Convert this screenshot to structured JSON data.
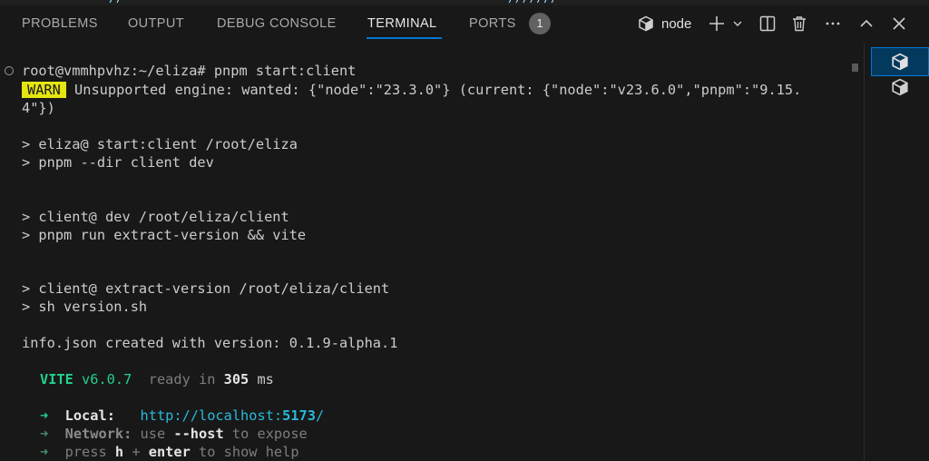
{
  "top_strip": {
    "fragments": [
      {
        "text": "// ---"
      },
      {
        "text": "─ ─ ─ ─"
      },
      {
        "text": "///////"
      },
      {
        "text": "─ ─ ─ ─ ─ ─"
      }
    ]
  },
  "panel": {
    "tabs": [
      {
        "label": "PROBLEMS",
        "active": false
      },
      {
        "label": "OUTPUT",
        "active": false
      },
      {
        "label": "DEBUG CONSOLE",
        "active": false
      },
      {
        "label": "TERMINAL",
        "active": true
      },
      {
        "label": "PORTS",
        "active": false
      }
    ],
    "ports_badge": "1",
    "terminal_name": "node",
    "accent_color": "#0078d4"
  },
  "terminal": {
    "prompt": "root@vmmhpvhz:~/eliza#",
    "command": " pnpm start:client",
    "warn_badge": "WARN",
    "warn_text": " Unsupported engine: wanted: {\"node\":\"23.3.0\"} (current: {\"node\":\"v23.6.0\",\"pnpm\":\"9.15.",
    "warn_text_cont": "4\"})",
    "line_eliza_script": "> eliza@ start:client /root/eliza",
    "line_pnpm_dir": "> pnpm --dir client dev",
    "line_client_dev": "> client@ dev /root/eliza/client",
    "line_pnpm_run": "> pnpm run extract-version && vite",
    "line_client_extract": "> client@ extract-version /root/eliza/client",
    "line_sh": "> sh version.sh",
    "line_info": "info.json created with version: 0.1.9-alpha.1",
    "vite_name": "VITE",
    "vite_version": " v6.0.7",
    "vite_ready": "  ready in ",
    "vite_ms": "305",
    "vite_ms_unit": " ms",
    "arrow": "➜",
    "local_label": "Local:",
    "local_url_prefix": "http://localhost:",
    "local_url_port": "5173",
    "local_url_suffix": "/",
    "network_label": "Network:",
    "network_use": " use ",
    "network_flag": "--host",
    "network_rest": " to expose",
    "help_press": "press ",
    "help_h": "h",
    "help_plus": " + ",
    "help_enter": "enter",
    "help_rest": " to show help"
  },
  "colors": {
    "background": "#181818",
    "warn_bg": "#e5e510",
    "green": "#23d18b",
    "url": "#29b8db"
  }
}
